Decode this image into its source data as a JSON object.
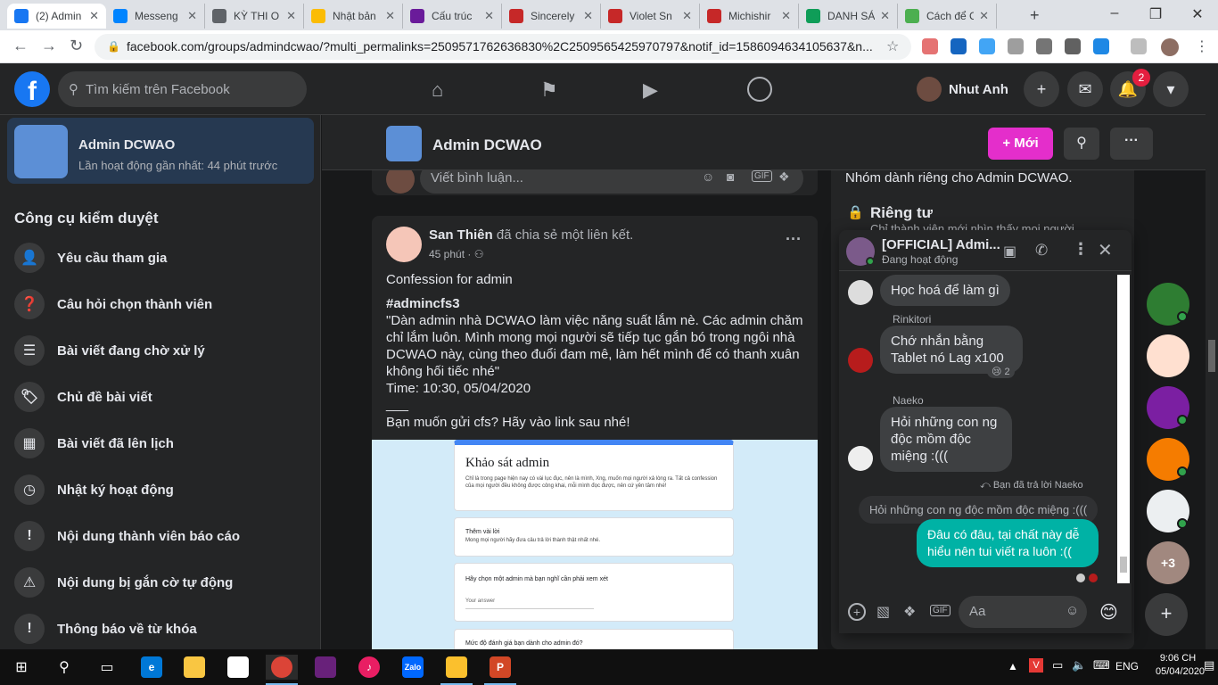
{
  "browser": {
    "tabs": [
      {
        "title": "(2) Admin",
        "color": "#1877f2",
        "active": true
      },
      {
        "title": "Messeng",
        "color": "#0084ff"
      },
      {
        "title": "KỲ THI O",
        "color": "#5f6368"
      },
      {
        "title": "Nhật bản",
        "color": "#fbbc04"
      },
      {
        "title": "Cấu trúc",
        "color": "#6a1b9a"
      },
      {
        "title": "Sincerely",
        "color": "#c62828"
      },
      {
        "title": "Violet Sn",
        "color": "#c62828"
      },
      {
        "title": "Michishir",
        "color": "#c62828"
      },
      {
        "title": "DANH SÁ",
        "color": "#0f9d58"
      },
      {
        "title": "Cách để C",
        "color": "#4caf50"
      }
    ],
    "new_tab": "+",
    "url": "facebook.com/groups/admindcwao/?multi_permalinks=2509571762636830%2C2509565425970797&notif_id=1586094634105637&n..."
  },
  "fb": {
    "search_placeholder": "Tìm kiếm trên Facebook",
    "profile_name": "Nhut Anh",
    "notif_count": "2"
  },
  "sidebar": {
    "group_name": "Admin DCWAO",
    "group_status": "Lần hoạt động gần nhất: 44 phút trước",
    "tools_heading": "Công cụ kiểm duyệt",
    "items": [
      {
        "label": "Yêu cầu tham gia",
        "icon": "person-add-icon",
        "glyph": "👤"
      },
      {
        "label": "Câu hỏi chọn thành viên",
        "icon": "question-icon",
        "glyph": "❓"
      },
      {
        "label": "Bài viết đang chờ xử lý",
        "icon": "pending-icon",
        "glyph": "☰"
      },
      {
        "label": "Chủ đề bài viết",
        "icon": "tag-icon",
        "glyph": "🏷"
      },
      {
        "label": "Bài viết đã lên lịch",
        "icon": "calendar-icon",
        "glyph": "▦"
      },
      {
        "label": "Nhật ký hoạt động",
        "icon": "clock-icon",
        "glyph": "◷"
      },
      {
        "label": "Nội dung thành viên báo cáo",
        "icon": "report-icon",
        "glyph": "!"
      },
      {
        "label": "Nội dung bị gắn cờ tự động",
        "icon": "warning-icon",
        "glyph": "⚠"
      },
      {
        "label": "Thông báo về từ khóa",
        "icon": "keyword-alert-icon",
        "glyph": "!"
      }
    ]
  },
  "group_bar": {
    "title": "Admin DCWAO",
    "new_button": "+ Mới"
  },
  "comment_box": {
    "placeholder": "Viết bình luận..."
  },
  "post": {
    "author": "San Thiên",
    "action": "đã chia sẻ một liên kết.",
    "time": "45 phút ·",
    "line1": "Confession for admin",
    "hashtag": "#admincfs3",
    "body": "\"Dàn admin nhà DCWAO làm việc năng suất lắm nè. Các admin chăm chỉ lắm luôn. Mình mong mọi người sẽ tiếp tục gắn bó trong ngôi nhà DCWAO này, cùng theo đuổi đam mê, làm hết mình để có thanh xuân không hối tiếc nhé\"",
    "time_line": "Time: 10:30, 05/04/2020",
    "divider": "___",
    "link_line": "Bạn muốn gửi cfs? Hãy vào link sau nhé!",
    "form": {
      "title": "Khảo sát admin",
      "desc": "Chỉ là trong page hiện nay có vài lục đục, nên là mình, Xng, muốn mọi người xả lòng ra. Tất cả confession của mọi người đều không được công khai, mỗi mình đọc được, nên cứ yên tâm nhé!",
      "q1_title": "Thêm vài lời",
      "q1_desc": "Mong mọi người hãy đưa câu trả lời thành thật nhất nhé.",
      "q2_title": "Hãy chọn một admin mà bạn nghĩ cần phải xem xét",
      "q2_answer": "Your answer",
      "q3_title": "Mức độ đánh giá bạn dành cho admin đó?"
    }
  },
  "right_panel": {
    "description": "Nhóm dành riêng cho Admin DCWAO.",
    "privacy_title": "Riêng tư",
    "privacy_sub": "Chỉ thành viên mới nhìn thấy mọi người"
  },
  "chat": {
    "title": "[OFFICIAL] Admi...",
    "status": "Đang hoạt động",
    "messages": {
      "m1": "Học hoá để làm gì",
      "sender2": "Rinkitori",
      "m2": "Chớ nhắn bằng Tablet nó Lag x100",
      "m2_reaction": "😢 2",
      "sender3": "Naeko",
      "m3": "Hỏi những con ng độc mồm độc miệng :(((",
      "reply_label": "Bạn đã trả lời Naeko",
      "quoted": "Hỏi những con ng độc mồm độc miệng :(((",
      "m4": "Đâu có đâu, tại chất này dễ hiểu nên tui viết ra luôn :(("
    },
    "input_placeholder": "Aa"
  },
  "rail": {
    "more_count": "+3"
  },
  "taskbar": {
    "language": "ENG",
    "time": "9:06 CH",
    "date": "05/04/2020"
  }
}
